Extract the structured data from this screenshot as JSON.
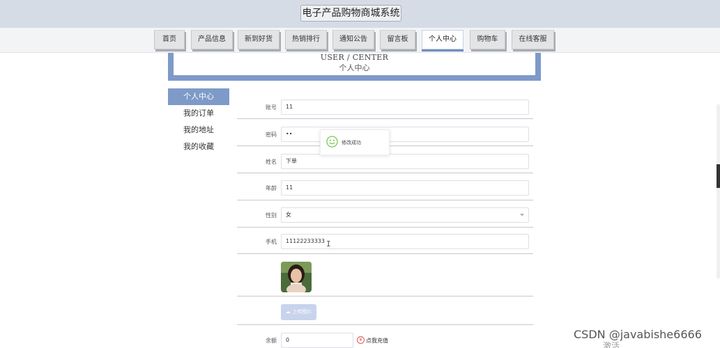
{
  "header": {
    "site_title": "电子产品购物商城系统"
  },
  "nav": [
    {
      "label": "首页"
    },
    {
      "label": "产品信息"
    },
    {
      "label": "新到好货"
    },
    {
      "label": "热销排行"
    },
    {
      "label": "通知公告"
    },
    {
      "label": "留言板"
    },
    {
      "label": "个人中心",
      "active": true
    },
    {
      "label": "购物车"
    },
    {
      "label": "在线客服"
    }
  ],
  "banner": {
    "en": "USER / CENTER",
    "cn": "个人中心"
  },
  "sidebar": {
    "items": [
      {
        "label": "个人中心",
        "active": true
      },
      {
        "label": "我的订单"
      },
      {
        "label": "我的地址"
      },
      {
        "label": "我的收藏"
      }
    ]
  },
  "form": {
    "account": {
      "label": "账号",
      "value": "11"
    },
    "password": {
      "label": "密码",
      "value": "••"
    },
    "name": {
      "label": "姓名",
      "value": "下单"
    },
    "age": {
      "label": "年龄",
      "value": "11"
    },
    "gender": {
      "label": "性别",
      "value": "女"
    },
    "phone": {
      "label": "手机",
      "value": "11122233333"
    },
    "upload_label": "上传图片",
    "balance": {
      "label": "余额",
      "value": "0"
    },
    "recharge_label": "点我充值"
  },
  "toast": {
    "message": "修改成功"
  },
  "overlay": {
    "watermark": "CSDN @javabishe6666",
    "activate": "激活"
  },
  "colors": {
    "accent": "#7e9ac8",
    "success": "#67c23a",
    "danger": "#e05a5a"
  }
}
